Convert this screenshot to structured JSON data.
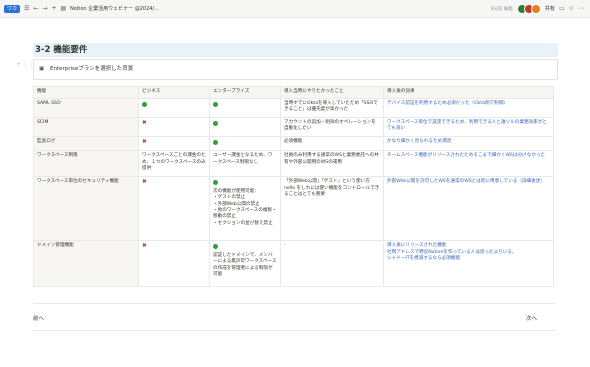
{
  "topbar": {
    "workspace_badge": "ワカ",
    "breadcrumb": "Notion 企業活用ウェビナー @2024/...",
    "edited": "8分前 編集",
    "share": "共有"
  },
  "heading": "3-2 機能要件",
  "callout": "Enterpriseプランを選択した背景",
  "table": {
    "headers": [
      "機能",
      "ビジネス",
      "エンタープライズ",
      "導入当時にやりたかったこと",
      "導入後の効果"
    ],
    "rows": [
      {
        "feature": "SAML SSO",
        "business": "check",
        "enterprise": "check",
        "wanted": "当時すでにOktaを導入していたため「SSOできること」は優先度が高かった",
        "effect": "デバイス認証を利用するため必須だった（Okta側で制御）"
      },
      {
        "feature": "SCIM",
        "business": "cross",
        "enterprise": "check",
        "wanted": "アカウントの追加・削除のオペレーションを自動化したい",
        "effect": "ワークスペース単位で設定できるため、利用できる人と誰ソルの業務効率がとても良い"
      },
      {
        "feature": "監査ログ",
        "business": "cross",
        "enterprise": "check",
        "wanted": "必須機能",
        "effect": "かなり細かく見られるため満足"
      },
      {
        "feature": "ワークスペース制限",
        "business_text": "ワークスペースごとの課金のため、１つのワークスペースのみ提供",
        "enterprise_text": "ユーザー課金となるため、ワークスペース制限なし",
        "wanted": "社員のみ利用する通常のWSと業務委託への共有や外部公開用のWSの運用",
        "effect": "チームスペース機能がリリースされたためそこまで細かくWSは分けなかった"
      },
      {
        "feature": "ワークスペース単位のセキュリティ機能",
        "business": "cross",
        "enterprise": "check",
        "enterprise_text": "次の機能が使用可能：\n・ゲストの禁止\n・外部Web公開の禁止\n・他のワークスペースの複製・移動の禁止\n・セクションの並び替え禁止",
        "wanted": "「外部Web公開」「ゲスト」という使い方 nello をしれには使い機能をコントロールできることはとても重要",
        "effect": "外部Web公開を許可したWSを通常のWSとは別に用意している（詳細後述）"
      },
      {
        "feature": "ドメイン管理機能",
        "business": "cross",
        "enterprise": "check",
        "enterprise_text": "認証したドメインで、メンバーによる無許可ワークスペースの作成を管理者による制限が可能",
        "wanted": "-",
        "effect": "導入後にリリースされた機能\n社用アドレスで野良Notionを作っている人は思ったよりいる。\nシャドーITを撲滅するなら必須機能"
      }
    ]
  },
  "footer": {
    "prev": "前へ",
    "next": "次へ"
  },
  "colors": {
    "heading_bg": "#e7f3f8",
    "check": "#2e9f3b",
    "cross": "#c0392b",
    "effect_text": "#3366b8"
  }
}
